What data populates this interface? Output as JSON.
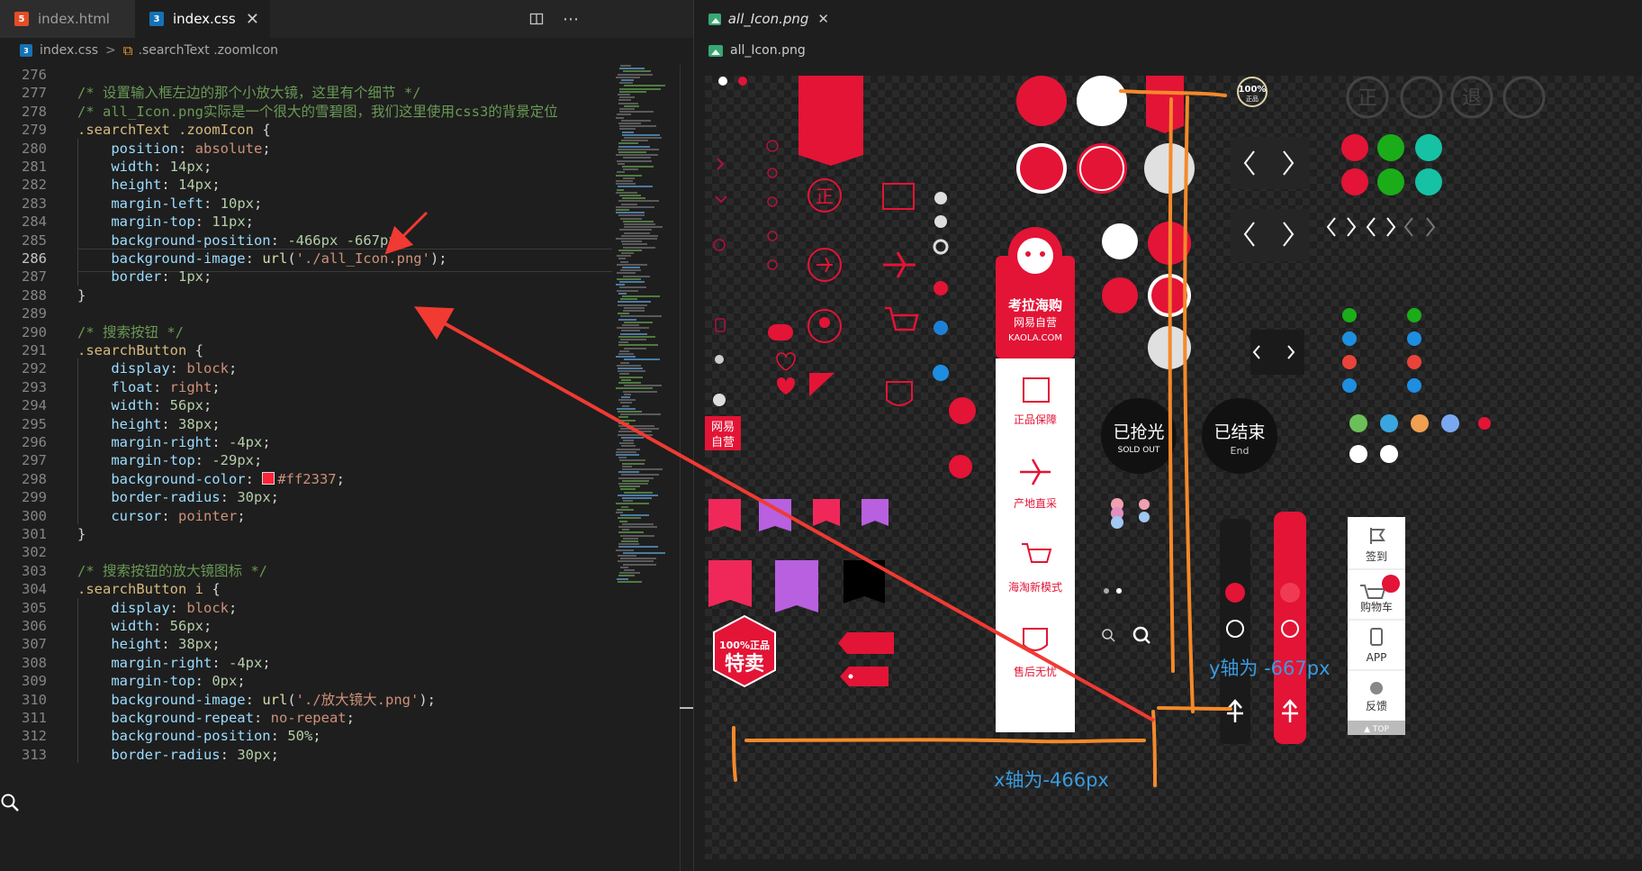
{
  "tabs": [
    {
      "name": "index.html",
      "icon": "html5-icon",
      "active": false
    },
    {
      "name": "index.css",
      "icon": "css3-icon",
      "active": true
    }
  ],
  "tab_close": "✕",
  "toolbar": {
    "split_icon": "split-editor-icon",
    "more_icon": "⋯"
  },
  "breadcrumb": {
    "file": "index.css",
    "symbol": ".searchText .zoomIcon",
    "separator": ">"
  },
  "code_lines": [
    {
      "n": "276",
      "html": ""
    },
    {
      "n": "277",
      "html": "<span class='t-com'>/* 设置输入框左边的那个小放大镜，这里有个细节 */</span>"
    },
    {
      "n": "278",
      "html": "<span class='t-com'>/* all_Icon.png实际是一个很大的雪碧图，我们这里使用css3的背景定位</span>"
    },
    {
      "n": "279",
      "html": "<span class='t-sel'>.searchText .zoomIcon</span> <span class='t-pun'>{</span>"
    },
    {
      "n": "280",
      "html": "    <span class='t-prop'>position</span>: <span class='t-val'>absolute</span>;"
    },
    {
      "n": "281",
      "html": "    <span class='t-prop'>width</span>: <span class='t-num'>14px</span>;"
    },
    {
      "n": "282",
      "html": "    <span class='t-prop'>height</span>: <span class='t-num'>14px</span>;"
    },
    {
      "n": "283",
      "html": "    <span class='t-prop'>margin-left</span>: <span class='t-num'>10px</span>;"
    },
    {
      "n": "284",
      "html": "    <span class='t-prop'>margin-top</span>: <span class='t-num'>11px</span>;"
    },
    {
      "n": "285",
      "html": "    <span class='t-prop'>background-position</span>: <span class='t-num'>-466px</span> <span class='t-num'>-667px</span>;"
    },
    {
      "n": "286",
      "html": "    <span class='t-prop'>background-image</span>: <span class='t-fn'>url</span>(<span class='t-str'>'./all_Icon.png'</span>);"
    },
    {
      "n": "287",
      "html": "    <span class='t-prop'>border</span>: <span class='t-num'>1px</span>;"
    },
    {
      "n": "288",
      "html": "<span class='t-pun'>}</span>"
    },
    {
      "n": "289",
      "html": ""
    },
    {
      "n": "290",
      "html": "<span class='t-com'>/* 搜索按钮 */</span>"
    },
    {
      "n": "291",
      "html": "<span class='t-sel'>.searchButton</span> <span class='t-pun'>{</span>"
    },
    {
      "n": "292",
      "html": "    <span class='t-prop'>display</span>: <span class='t-val'>block</span>;"
    },
    {
      "n": "293",
      "html": "    <span class='t-prop'>float</span>: <span class='t-val'>right</span>;"
    },
    {
      "n": "294",
      "html": "    <span class='t-prop'>width</span>: <span class='t-num'>56px</span>;"
    },
    {
      "n": "295",
      "html": "    <span class='t-prop'>height</span>: <span class='t-num'>38px</span>;"
    },
    {
      "n": "296",
      "html": "    <span class='t-prop'>margin-right</span>: <span class='t-num'>-4px</span>;"
    },
    {
      "n": "297",
      "html": "    <span class='t-prop'>margin-top</span>: <span class='t-num'>-29px</span>;"
    },
    {
      "n": "298",
      "html": "    <span class='t-prop'>background-color</span>: <span class='swatch'></span><span class='t-val'>#ff2337</span>;"
    },
    {
      "n": "299",
      "html": "    <span class='t-prop'>border-radius</span>: <span class='t-num'>30px</span>;"
    },
    {
      "n": "300",
      "html": "    <span class='t-prop'>cursor</span>: <span class='t-val'>pointer</span>;"
    },
    {
      "n": "301",
      "html": "<span class='t-pun'>}</span>"
    },
    {
      "n": "302",
      "html": ""
    },
    {
      "n": "303",
      "html": "<span class='t-com'>/* 搜索按钮的放大镜图标 */</span>"
    },
    {
      "n": "304",
      "html": "<span class='t-sel'>.searchButton i</span> <span class='t-pun'>{</span>"
    },
    {
      "n": "305",
      "html": "    <span class='t-prop'>display</span>: <span class='t-val'>block</span>;"
    },
    {
      "n": "306",
      "html": "    <span class='t-prop'>width</span>: <span class='t-num'>56px</span>;"
    },
    {
      "n": "307",
      "html": "    <span class='t-prop'>height</span>: <span class='t-num'>38px</span>;"
    },
    {
      "n": "308",
      "html": "    <span class='t-prop'>margin-right</span>: <span class='t-num'>-4px</span>;"
    },
    {
      "n": "309",
      "html": "    <span class='t-prop'>margin-top</span>: <span class='t-num'>0px</span>;"
    },
    {
      "n": "310",
      "html": "    <span class='t-prop'>background-image</span>: <span class='t-fn'>url</span>(<span class='t-str'>'./放大镜大.png'</span>);"
    },
    {
      "n": "311",
      "html": "    <span class='t-prop'>background-repeat</span>: <span class='t-val'>no-repeat</span>;"
    },
    {
      "n": "312",
      "html": "    <span class='t-prop'>background-position</span>: <span class='t-num'>50%</span>;"
    },
    {
      "n": "313",
      "html": "    <span class='t-prop'>border-radius</span>: <span class='t-num'>30px</span>;"
    }
  ],
  "viewer": {
    "tab_name": "all_Icon.png",
    "breadcrumb_file": "all_Icon.png"
  },
  "sprite_text": {
    "zheng": "正",
    "kaola_brand": "考拉海购",
    "kaola_sub": "网易自营",
    "kaola_url": "KAOLA.COM",
    "feature_1": "正品保障",
    "feature_2": "产地直采",
    "feature_3": "海淘新模式",
    "feature_4": "售后无忧",
    "sold_out_cn": "已抢光",
    "sold_out_en": "SOLD OUT",
    "ended_cn": "已结束",
    "ended_en": "End",
    "netease_line1": "网易",
    "netease_line2": "自营",
    "badge_100": "100%",
    "badge_100_sub": "正品",
    "tmall_pct": "100%正品",
    "tmall_big": "特卖",
    "circle_1": "正",
    "circle_2": "退",
    "side_1": "签到",
    "side_2": "购物车",
    "side_3": "APP",
    "side_4": "反馈",
    "side_top": "▲ TOP"
  },
  "annotations": {
    "y_axis_label": "y轴为 -667px",
    "x_axis_label": "x轴为-466px"
  },
  "colors": {
    "accent_red": "#e31436",
    "css_swatch": "#ff2337",
    "annotation_blue": "#3a9be0",
    "annotation_orange": "#f5892a",
    "arrow_red": "#f03a32"
  }
}
